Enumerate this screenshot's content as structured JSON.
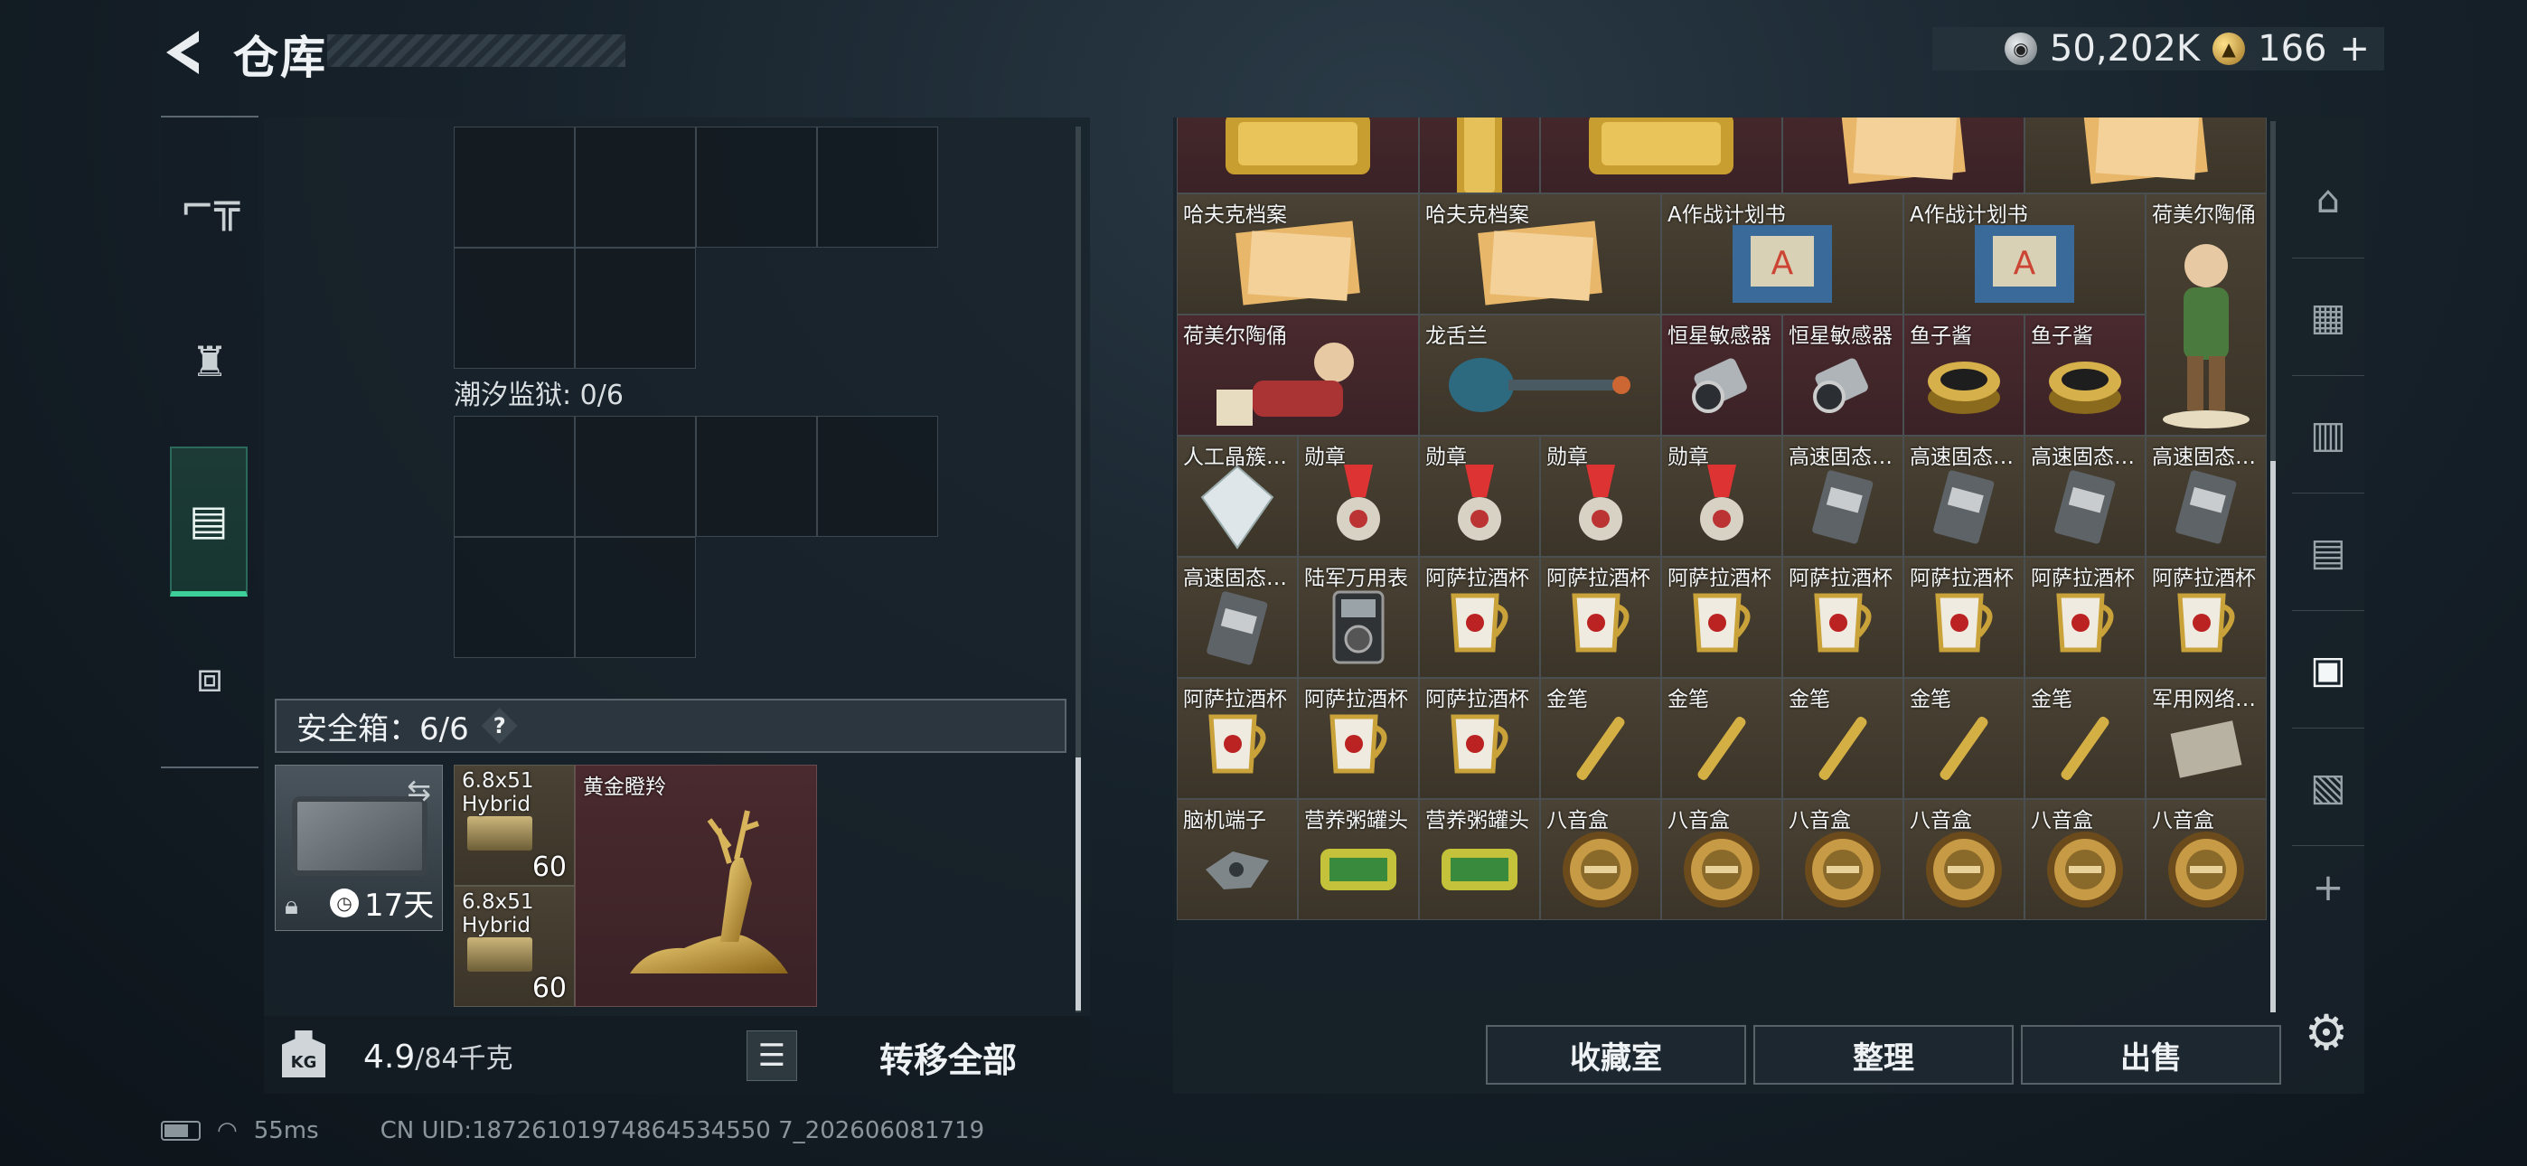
{
  "header": {
    "title": "仓库",
    "silver_amount": "50,202K",
    "gold_amount": "166",
    "gold_plus": "+"
  },
  "left_nav": [
    {
      "icon": "pistol-icon"
    },
    {
      "icon": "backpack-icon"
    },
    {
      "icon": "rig-icon",
      "active": true
    },
    {
      "icon": "toolbox-icon"
    }
  ],
  "left": {
    "prison_label": "潮汐监狱: 0/6",
    "safebox_label": "安全箱：6/6",
    "help": "?",
    "safebox_timer": "17天",
    "ammo1": {
      "name": "6.8x51",
      "sub": "Hybrid",
      "count": "60"
    },
    "ammo2": {
      "name": "6.8x51",
      "sub": "Hybrid",
      "count": "60"
    },
    "deer": {
      "name": "黄金瞪羚"
    },
    "weight_current": "4.9",
    "weight_max": "/84千克",
    "transfer_label": "转移全部"
  },
  "stash": {
    "top_row": [
      "金条",
      "",
      "金条",
      "哈夫克档案",
      "哈夫克档案"
    ],
    "rows": [
      [
        "哈夫克档案",
        "",
        "哈夫克档案",
        "",
        "A作战计划书",
        "",
        "A作战计划书",
        "",
        "荷美尔陶俑"
      ],
      [
        "荷美尔陶俑",
        "",
        "龙舌兰",
        "",
        "恒星敏感器",
        "恒星敏感器",
        "鱼子酱",
        "鱼子酱"
      ],
      [
        "人工晶簇…",
        "勋章",
        "勋章",
        "勋章",
        "勋章",
        "高速固态…",
        "高速固态…",
        "高速固态…",
        "高速固态…"
      ],
      [
        "高速固态…",
        "陆军万用表",
        "阿萨拉酒杯",
        "阿萨拉酒杯",
        "阿萨拉酒杯",
        "阿萨拉酒杯",
        "阿萨拉酒杯",
        "阿萨拉酒杯",
        "阿萨拉酒杯"
      ],
      [
        "阿萨拉酒杯",
        "阿萨拉酒杯",
        "阿萨拉酒杯",
        "金笔",
        "金笔",
        "金笔",
        "金笔",
        "金笔",
        "军用网络…"
      ],
      [
        "脑机端子",
        "营养粥罐头",
        "营养粥罐头",
        "八音盒",
        "八音盒",
        "八音盒",
        "八音盒",
        "八音盒",
        "八音盒"
      ]
    ]
  },
  "actions": {
    "collection": "收藏室",
    "sort": "整理",
    "sell": "出售"
  },
  "status": {
    "ping": "55ms",
    "uid": "CN UID:18726101974864534550 7_202606081719"
  },
  "colors": {
    "accent": "#3dcf98",
    "rare_red": "#4a2a2e",
    "gold_bar": "#c9a23a"
  }
}
